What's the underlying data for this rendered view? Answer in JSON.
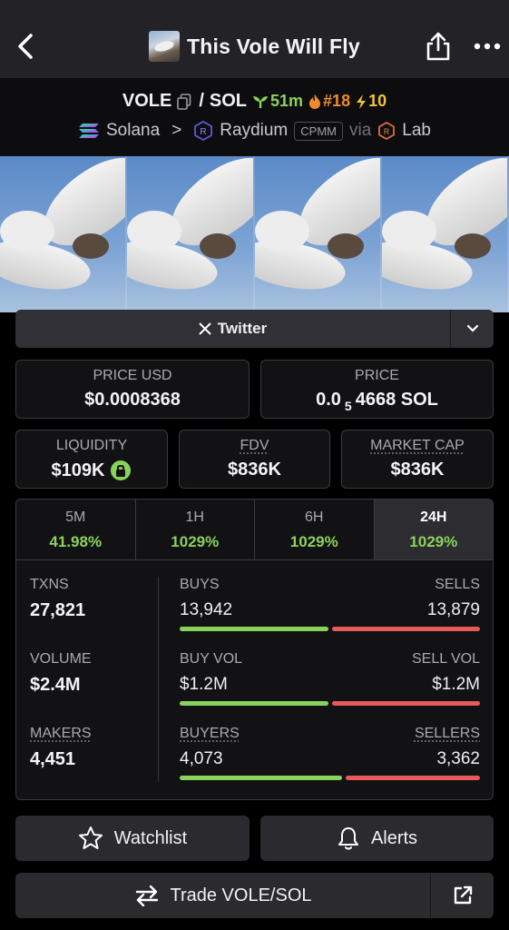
{
  "header": {
    "title": "This Vole Will Fly"
  },
  "pair": {
    "base": "VOLE",
    "separator": "/",
    "quote": "SOL",
    "age": "51m",
    "rank": "#18",
    "boosts": "10",
    "chain": "Solana",
    "arrow": ">",
    "dex": "Raydium",
    "pool_type": "CPMM",
    "via": "via",
    "launchpad": "Lab"
  },
  "social": {
    "twitter_label": "Twitter"
  },
  "price": {
    "usd_label": "PRICE USD",
    "usd_value": "$0.0008368",
    "native_label": "PRICE",
    "native_prefix": "0.0",
    "native_zeros": "5",
    "native_digits": "4668 SOL"
  },
  "metrics": {
    "liquidity_label": "LIQUIDITY",
    "liquidity_value": "$109K",
    "fdv_label": "FDV",
    "fdv_value": "$836K",
    "mcap_label": "MARKET CAP",
    "mcap_value": "$836K"
  },
  "tabs": [
    {
      "label": "5M",
      "change": "41.98%"
    },
    {
      "label": "1H",
      "change": "1029%"
    },
    {
      "label": "6H",
      "change": "1029%"
    },
    {
      "label": "24H",
      "change": "1029%"
    }
  ],
  "stats": {
    "txns_label": "TXNS",
    "txns_value": "27,821",
    "volume_label": "VOLUME",
    "volume_value": "$2.4M",
    "makers_label": "MAKERS",
    "makers_value": "4,451",
    "buys_label": "BUYS",
    "buys_value": "13,942",
    "sells_label": "SELLS",
    "sells_value": "13,879",
    "buyvol_label": "BUY VOL",
    "buyvol_value": "$1.2M",
    "sellvol_label": "SELL VOL",
    "sellvol_value": "$1.2M",
    "buyers_label": "BUYERS",
    "buyers_value": "4,073",
    "sellers_label": "SELLERS",
    "sellers_value": "3,362",
    "buys_ratio": 0.501,
    "buyvol_ratio": 0.5,
    "buyers_ratio": 0.548
  },
  "actions": {
    "watchlist_label": "Watchlist",
    "alerts_label": "Alerts",
    "trade_label": "Trade VOLE/SOL"
  },
  "colors": {
    "positive": "#8ad35a",
    "negative": "#e85a5a",
    "rank": "#f08a2c",
    "boost": "#f2c531"
  }
}
